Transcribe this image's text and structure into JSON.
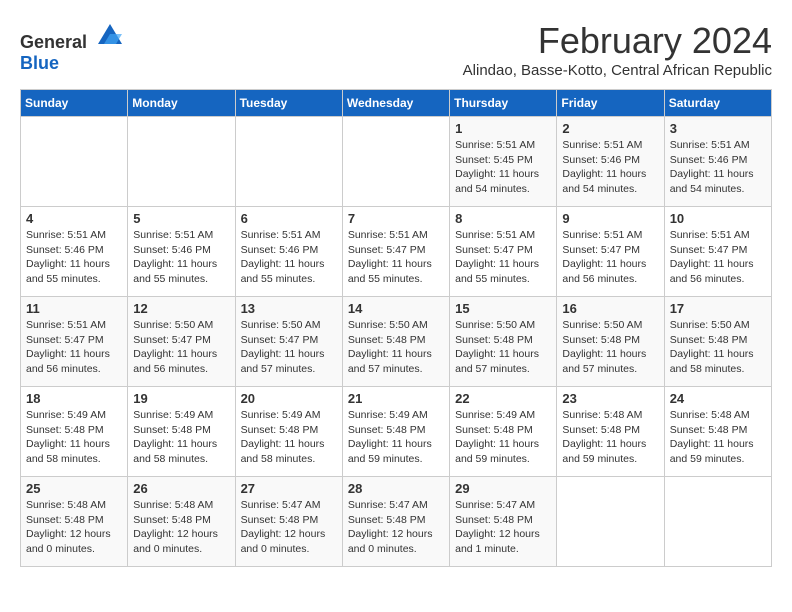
{
  "logo": {
    "general": "General",
    "blue": "Blue"
  },
  "title": "February 2024",
  "subtitle": "Alindao, Basse-Kotto, Central African Republic",
  "headers": [
    "Sunday",
    "Monday",
    "Tuesday",
    "Wednesday",
    "Thursday",
    "Friday",
    "Saturday"
  ],
  "weeks": [
    [
      {
        "num": "",
        "info": ""
      },
      {
        "num": "",
        "info": ""
      },
      {
        "num": "",
        "info": ""
      },
      {
        "num": "",
        "info": ""
      },
      {
        "num": "1",
        "info": "Sunrise: 5:51 AM\nSunset: 5:45 PM\nDaylight: 11 hours and 54 minutes."
      },
      {
        "num": "2",
        "info": "Sunrise: 5:51 AM\nSunset: 5:46 PM\nDaylight: 11 hours and 54 minutes."
      },
      {
        "num": "3",
        "info": "Sunrise: 5:51 AM\nSunset: 5:46 PM\nDaylight: 11 hours and 54 minutes."
      }
    ],
    [
      {
        "num": "4",
        "info": "Sunrise: 5:51 AM\nSunset: 5:46 PM\nDaylight: 11 hours and 55 minutes."
      },
      {
        "num": "5",
        "info": "Sunrise: 5:51 AM\nSunset: 5:46 PM\nDaylight: 11 hours and 55 minutes."
      },
      {
        "num": "6",
        "info": "Sunrise: 5:51 AM\nSunset: 5:46 PM\nDaylight: 11 hours and 55 minutes."
      },
      {
        "num": "7",
        "info": "Sunrise: 5:51 AM\nSunset: 5:47 PM\nDaylight: 11 hours and 55 minutes."
      },
      {
        "num": "8",
        "info": "Sunrise: 5:51 AM\nSunset: 5:47 PM\nDaylight: 11 hours and 55 minutes."
      },
      {
        "num": "9",
        "info": "Sunrise: 5:51 AM\nSunset: 5:47 PM\nDaylight: 11 hours and 56 minutes."
      },
      {
        "num": "10",
        "info": "Sunrise: 5:51 AM\nSunset: 5:47 PM\nDaylight: 11 hours and 56 minutes."
      }
    ],
    [
      {
        "num": "11",
        "info": "Sunrise: 5:51 AM\nSunset: 5:47 PM\nDaylight: 11 hours and 56 minutes."
      },
      {
        "num": "12",
        "info": "Sunrise: 5:50 AM\nSunset: 5:47 PM\nDaylight: 11 hours and 56 minutes."
      },
      {
        "num": "13",
        "info": "Sunrise: 5:50 AM\nSunset: 5:47 PM\nDaylight: 11 hours and 57 minutes."
      },
      {
        "num": "14",
        "info": "Sunrise: 5:50 AM\nSunset: 5:48 PM\nDaylight: 11 hours and 57 minutes."
      },
      {
        "num": "15",
        "info": "Sunrise: 5:50 AM\nSunset: 5:48 PM\nDaylight: 11 hours and 57 minutes."
      },
      {
        "num": "16",
        "info": "Sunrise: 5:50 AM\nSunset: 5:48 PM\nDaylight: 11 hours and 57 minutes."
      },
      {
        "num": "17",
        "info": "Sunrise: 5:50 AM\nSunset: 5:48 PM\nDaylight: 11 hours and 58 minutes."
      }
    ],
    [
      {
        "num": "18",
        "info": "Sunrise: 5:49 AM\nSunset: 5:48 PM\nDaylight: 11 hours and 58 minutes."
      },
      {
        "num": "19",
        "info": "Sunrise: 5:49 AM\nSunset: 5:48 PM\nDaylight: 11 hours and 58 minutes."
      },
      {
        "num": "20",
        "info": "Sunrise: 5:49 AM\nSunset: 5:48 PM\nDaylight: 11 hours and 58 minutes."
      },
      {
        "num": "21",
        "info": "Sunrise: 5:49 AM\nSunset: 5:48 PM\nDaylight: 11 hours and 59 minutes."
      },
      {
        "num": "22",
        "info": "Sunrise: 5:49 AM\nSunset: 5:48 PM\nDaylight: 11 hours and 59 minutes."
      },
      {
        "num": "23",
        "info": "Sunrise: 5:48 AM\nSunset: 5:48 PM\nDaylight: 11 hours and 59 minutes."
      },
      {
        "num": "24",
        "info": "Sunrise: 5:48 AM\nSunset: 5:48 PM\nDaylight: 11 hours and 59 minutes."
      }
    ],
    [
      {
        "num": "25",
        "info": "Sunrise: 5:48 AM\nSunset: 5:48 PM\nDaylight: 12 hours and 0 minutes."
      },
      {
        "num": "26",
        "info": "Sunrise: 5:48 AM\nSunset: 5:48 PM\nDaylight: 12 hours and 0 minutes."
      },
      {
        "num": "27",
        "info": "Sunrise: 5:47 AM\nSunset: 5:48 PM\nDaylight: 12 hours and 0 minutes."
      },
      {
        "num": "28",
        "info": "Sunrise: 5:47 AM\nSunset: 5:48 PM\nDaylight: 12 hours and 0 minutes."
      },
      {
        "num": "29",
        "info": "Sunrise: 5:47 AM\nSunset: 5:48 PM\nDaylight: 12 hours and 1 minute."
      },
      {
        "num": "",
        "info": ""
      },
      {
        "num": "",
        "info": ""
      }
    ]
  ]
}
